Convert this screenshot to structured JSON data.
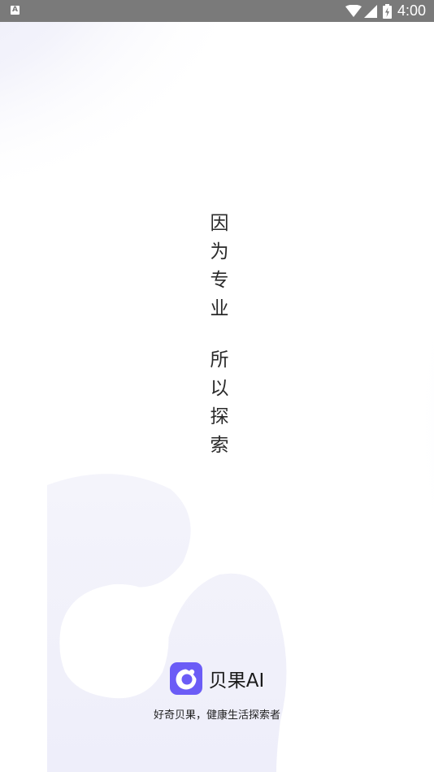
{
  "status_bar": {
    "app_icon_letter": "A",
    "time": "4:00"
  },
  "slogan": {
    "line1": "因为专业",
    "line2": "所以探索"
  },
  "brand": {
    "name": "贝果AI",
    "tagline": "好奇贝果，健康生活探索者",
    "accent_color": "#6b5cf6"
  },
  "icons": [
    "wifi-icon",
    "cell-signal-icon",
    "battery-charging-icon",
    "beiguo-logo-icon"
  ]
}
